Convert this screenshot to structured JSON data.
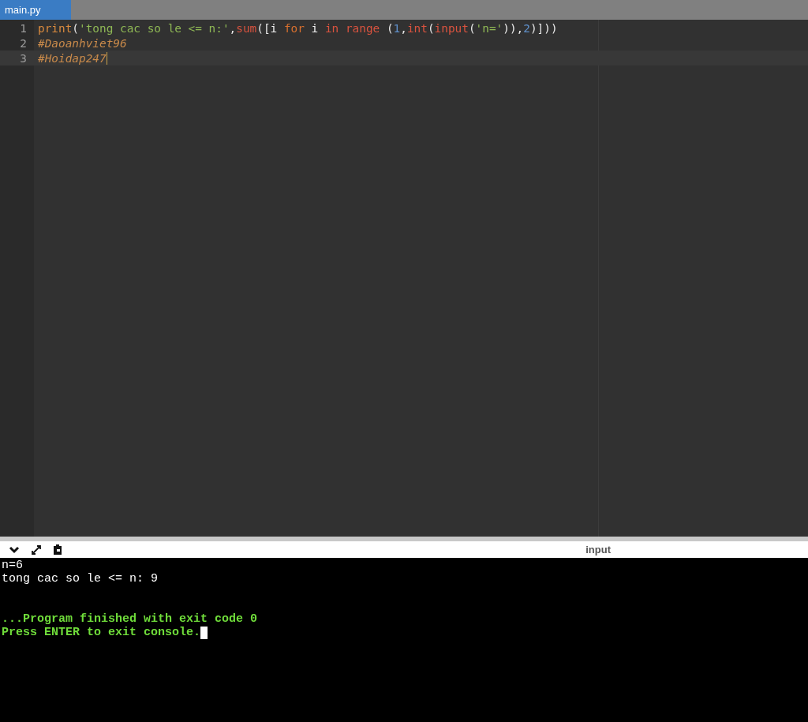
{
  "tabs": [
    {
      "label": "main.py",
      "selected": true
    }
  ],
  "editor": {
    "lines": [
      {
        "number": "1",
        "active": false,
        "tokens": [
          {
            "kind": "builtin",
            "text": "print"
          },
          {
            "kind": "punct",
            "text": "("
          },
          {
            "kind": "string",
            "text": "'tong cac so le <= n:'"
          },
          {
            "kind": "punct",
            "text": ","
          },
          {
            "kind": "call",
            "text": "sum"
          },
          {
            "kind": "punct",
            "text": "(["
          },
          {
            "kind": "name",
            "text": "i "
          },
          {
            "kind": "keyword",
            "text": "for"
          },
          {
            "kind": "name",
            "text": " i "
          },
          {
            "kind": "call",
            "text": "in range"
          },
          {
            "kind": "punct",
            "text": " ("
          },
          {
            "kind": "number",
            "text": "1"
          },
          {
            "kind": "punct",
            "text": ","
          },
          {
            "kind": "call",
            "text": "int"
          },
          {
            "kind": "punct",
            "text": "("
          },
          {
            "kind": "call",
            "text": "input"
          },
          {
            "kind": "punct",
            "text": "("
          },
          {
            "kind": "string",
            "text": "'n='"
          },
          {
            "kind": "punct",
            "text": ")),"
          },
          {
            "kind": "number",
            "text": "2"
          },
          {
            "kind": "punct",
            "text": ")]))"
          }
        ]
      },
      {
        "number": "2",
        "active": false,
        "tokens": [
          {
            "kind": "comment",
            "text": "#Daoanhviet96"
          }
        ]
      },
      {
        "number": "3",
        "active": true,
        "tokens": [
          {
            "kind": "comment",
            "text": "#Hoidap247"
          }
        ]
      }
    ]
  },
  "console": {
    "label": "input",
    "lines": [
      {
        "kind": "output",
        "text": "n=6"
      },
      {
        "kind": "output",
        "text": "tong cac so le <= n: 9"
      },
      {
        "kind": "blank"
      },
      {
        "kind": "blank"
      },
      {
        "kind": "status",
        "text": "...Program finished with exit code 0"
      },
      {
        "kind": "status",
        "text": "Press ENTER to exit console.",
        "cursor": true
      }
    ]
  }
}
